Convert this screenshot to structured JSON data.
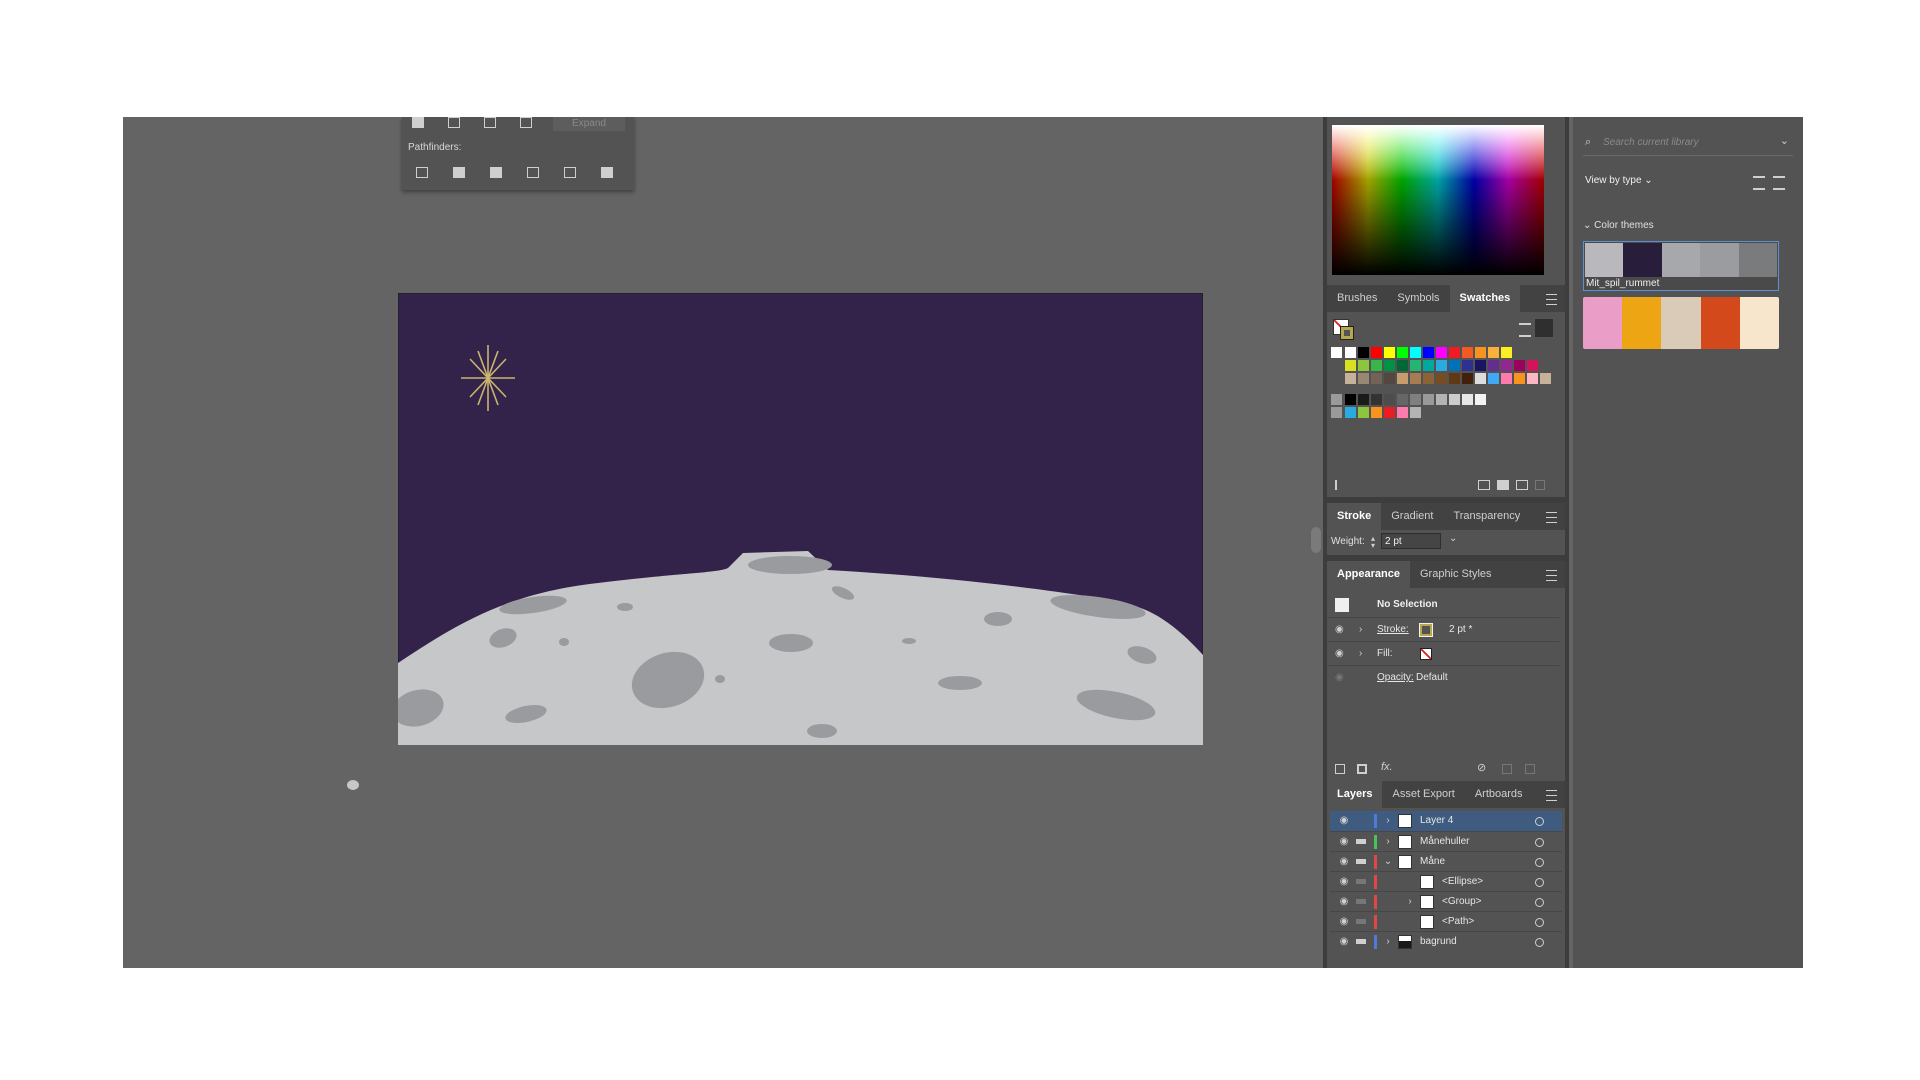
{
  "pathfinder": {
    "expand_label": "Expand",
    "pathfinders_label": "Pathfinders:"
  },
  "swatch_panel": {
    "tabs": [
      "Brushes",
      "Symbols",
      "Swatches"
    ],
    "active_tab": "Swatches"
  },
  "stroke_panel": {
    "tabs": [
      "Stroke",
      "Gradient",
      "Transparency"
    ],
    "weight_label": "Weight:",
    "weight_value": "2 pt"
  },
  "appearance_panel": {
    "tabs": [
      "Appearance",
      "Graphic Styles"
    ],
    "title": "No Selection",
    "stroke_label": "Stroke:",
    "stroke_value": "2 pt *",
    "fill_label": "Fill:",
    "opacity_label": "Opacity:",
    "opacity_value": "Default"
  },
  "layers_panel": {
    "tabs": [
      "Layers",
      "Asset Export",
      "Artboards"
    ],
    "rows": [
      {
        "name": "Layer 4",
        "color": "#4f7ad8",
        "selected": true
      },
      {
        "name": "Månehuller",
        "color": "#49c25a"
      },
      {
        "name": "Måne",
        "color": "#e04848"
      },
      {
        "name": "<Ellipse>",
        "color": "#e04848"
      },
      {
        "name": "<Group>",
        "color": "#e04848"
      },
      {
        "name": "<Path>",
        "color": "#e04848"
      },
      {
        "name": "bagrund",
        "color": "#4f7ad8"
      }
    ]
  },
  "library_panel": {
    "search_placeholder": "Search current library",
    "view_by": "View by type",
    "section": "Color themes",
    "themes": [
      {
        "name": "Mit_spil_rummet",
        "colors": [
          "#b9b9bd",
          "#281d3b",
          "#a6a8ab",
          "#9a9c9f",
          "#7a7b7d"
        ]
      },
      {
        "name": "",
        "colors": [
          "#ea9ec7",
          "#eda514",
          "#d9cbb8",
          "#d4491c",
          "#f7e6cc"
        ]
      }
    ]
  },
  "colors": {
    "canvas_bg": "#646464",
    "sky": "#33224a",
    "moon": "#c6c7c9",
    "crater": "#9a9b9e",
    "star": "#c9b46e",
    "layer_selected": "#3f5c80"
  },
  "swatch_rows": [
    [
      "#ffffff",
      "#000000",
      "#ff0000",
      "#ffff00",
      "#00ff00",
      "#00ffff",
      "#0000ff",
      "#ff00ff",
      "#ed1c24",
      "#f15a24",
      "#f7931e",
      "#fbb03b",
      "#fcee21"
    ],
    [
      "#d9e021",
      "#8cc63f",
      "#39b54a",
      "#009245",
      "#006837",
      "#22b573",
      "#00a99d",
      "#29abe2",
      "#0071bc",
      "#2e3192",
      "#1b1464",
      "#662d91",
      "#93278f",
      "#9e005d",
      "#d4145a"
    ],
    [
      "#c7b299",
      "#998675",
      "#736357",
      "#534741",
      "#c69c6d",
      "#a67c52",
      "#8c6239",
      "#754c24",
      "#603813",
      "#42210b",
      "#dddddd",
      "#3fa9f5",
      "#ff7bac",
      "#f7931e",
      "#fbb8c4",
      "#c7b299"
    ],
    [
      "#000000",
      "#1a1a1a",
      "#333333",
      "#4d4d4d",
      "#666666",
      "#808080",
      "#999999",
      "#b3b3b3",
      "#cccccc",
      "#e6e6e6",
      "#f2f2f2"
    ],
    [
      "#29abe2",
      "#8cc63f",
      "#f7931e",
      "#ed1c24",
      "#ff7bac",
      "#b3b3b3"
    ]
  ]
}
